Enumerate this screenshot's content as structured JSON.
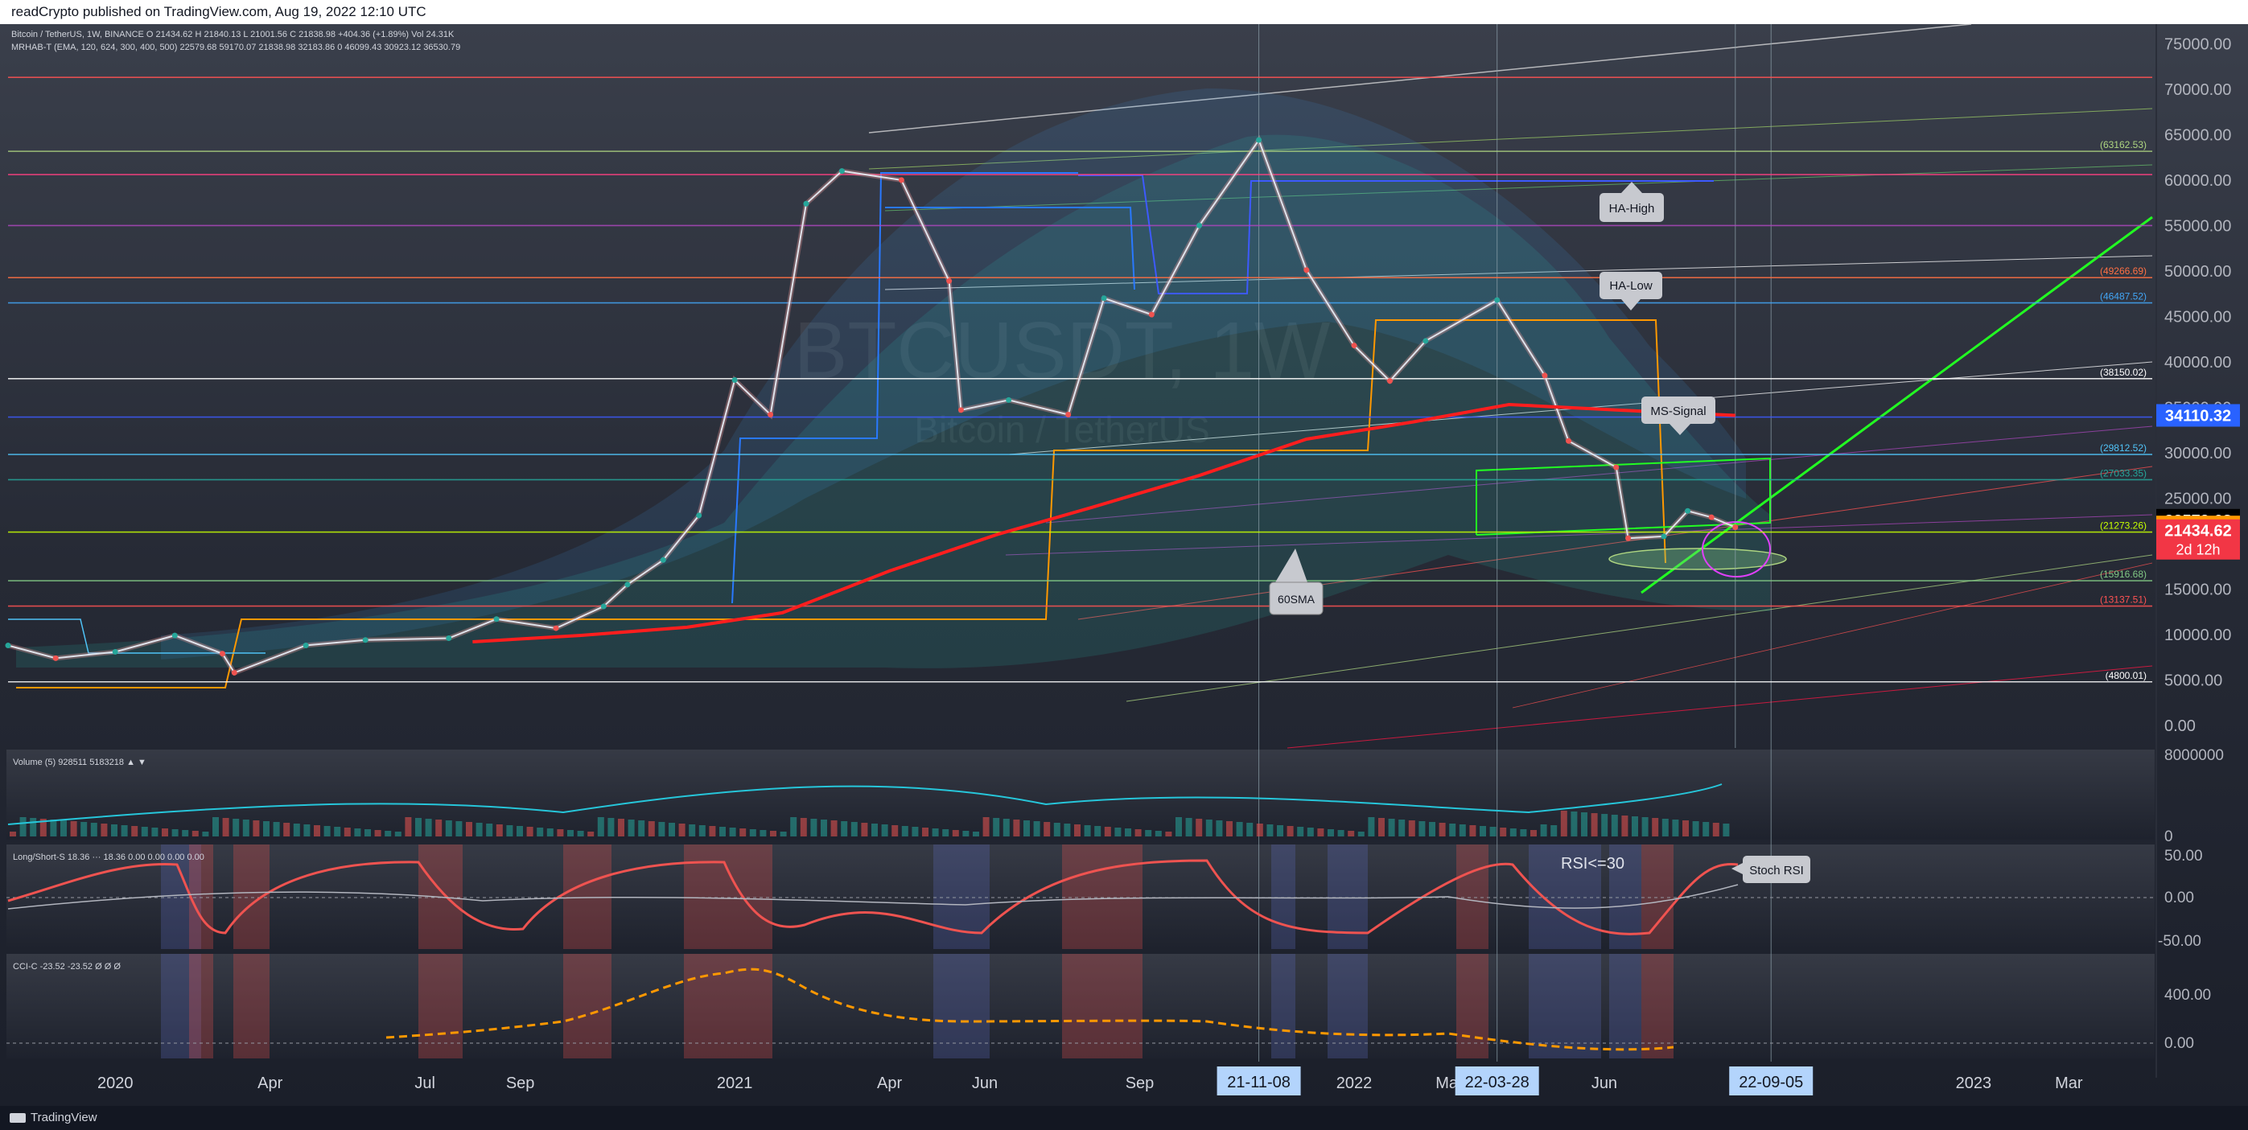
{
  "header": {
    "publish_text": "readCrypto published on TradingView.com, Aug 19, 2022 12:10 UTC"
  },
  "footer": {
    "brand": "TradingView"
  },
  "colors": {
    "bg": "#131722",
    "red": "#ff1e1e",
    "green": "#22ff22",
    "axis_text": "#b2b5be",
    "white": "#ffffff"
  },
  "legend": {
    "line1": "Bitcoin / TetherUS, 1W, BINANCE  O 21434.62  H 21840.13  L 21001.56  C 21838.98  +404.36 (+1.89%)  Vol 24.31K",
    "line2": "MRHAB-T (EMA, 120, 624, 300, 400, 500)  22579.68  59170.07  21838.98  32183.86  0  46099.43  30923.12  36530.79"
  },
  "watermark": {
    "symbol": "BTCUSDT, 1W",
    "name": "Bitcoin / TetherUS"
  },
  "chart_data": {
    "type": "candlestick",
    "symbol": "BTCUSDT",
    "interval": "1W",
    "ylim": [
      0,
      77500
    ],
    "yticks": [
      0,
      5000,
      10000,
      15000,
      20000,
      25000,
      30000,
      35000,
      40000,
      45000,
      50000,
      55000,
      60000,
      65000,
      70000,
      75000
    ],
    "ytick_labels": [
      "0.00",
      "5000.00",
      "10000.00",
      "15000.00",
      "20000.00",
      "25000.00",
      "30000.00",
      "35000.00",
      "40000.00",
      "45000.00",
      "50000.00",
      "55000.00",
      "60000.00",
      "65000.00",
      "70000.00",
      "75000.00"
    ],
    "x_start": "2019-11-04",
    "x_end": "2023-04-17",
    "xticks": [
      {
        "label": "2020",
        "date": "2020-01-06"
      },
      {
        "label": "Apr",
        "date": "2020-04-06"
      },
      {
        "label": "Jul",
        "date": "2020-07-06"
      },
      {
        "label": "Sep",
        "date": "2020-08-31"
      },
      {
        "label": "2021",
        "date": "2021-01-04"
      },
      {
        "label": "Apr",
        "date": "2021-04-05"
      },
      {
        "label": "Jun",
        "date": "2021-05-31"
      },
      {
        "label": "Sep",
        "date": "2021-08-30"
      },
      {
        "label": "2022",
        "date": "2022-01-03"
      },
      {
        "label": "Mar",
        "date": "2022-02-28"
      },
      {
        "label": "Jun",
        "date": "2022-05-30"
      },
      {
        "label": "2023",
        "date": "2023-01-02"
      },
      {
        "label": "Mar",
        "date": "2023-02-27"
      }
    ],
    "date_markers": [
      {
        "label": "21-11-08",
        "date": "2021-11-08"
      },
      {
        "label": "22-03-28",
        "date": "2022-03-28"
      },
      {
        "label": "22-09-05",
        "date": "2022-09-05"
      }
    ],
    "vlines": [
      {
        "date": "2022-08-15"
      }
    ],
    "hlevels": [
      {
        "value": 4800.01,
        "label": "(4800.01)",
        "color": "#ffffff"
      },
      {
        "value": 13137.51,
        "label": "(13137.51)",
        "color": "#ff5252"
      },
      {
        "value": 15916.68,
        "label": "(15916.68)",
        "color": "#81c784"
      },
      {
        "value": 21273.26,
        "label": "(21273.26)",
        "color": "#c6ff00"
      },
      {
        "value": 27033.35,
        "label": "(27033.35)",
        "color": "#26a69a"
      },
      {
        "value": 29812.52,
        "label": "(29812.52)",
        "color": "#4fc3f7"
      },
      {
        "value": 33923.0,
        "label": "",
        "color": "#3d5afe"
      },
      {
        "value": 38150.02,
        "label": "(38150.02)",
        "color": "#ffffff"
      },
      {
        "value": 46487.52,
        "label": "(46487.52)",
        "color": "#42a5f5"
      },
      {
        "value": 49266.69,
        "label": "(49266.69)",
        "color": "#ff7043"
      },
      {
        "value": 55000.0,
        "label": "",
        "color": "#ab47bc"
      },
      {
        "value": 60600.0,
        "label": "",
        "color": "#ff4081"
      },
      {
        "value": 63162.53,
        "label": "(63162.53)",
        "color": "#aed581"
      },
      {
        "value": 71300.0,
        "label": "",
        "color": "#ff5252"
      }
    ],
    "price_tags": [
      {
        "value": 34110.32,
        "label": "34110.32",
        "bg": "#2962ff",
        "fg": "#ffffff"
      },
      {
        "value": 22579.68,
        "label": "22579.68",
        "bg": "#000000",
        "fg": "#ffffff"
      },
      {
        "value": 21838.98,
        "label": "21838.98",
        "bg": "#ff9800",
        "fg": "#000000"
      },
      {
        "value": 21434.62,
        "label": "21434.62",
        "bg": "#f23645",
        "fg": "#ffffff",
        "sub": "2d 12h"
      }
    ],
    "close_series": {
      "name": "BTCUSDT weekly close",
      "x": [
        "2019-11-04",
        "2019-12-02",
        "2020-01-06",
        "2020-02-10",
        "2020-03-09",
        "2020-03-16",
        "2020-04-27",
        "2020-06-01",
        "2020-07-20",
        "2020-08-17",
        "2020-09-21",
        "2020-10-19",
        "2020-11-02",
        "2020-11-23",
        "2020-12-14",
        "2021-01-04",
        "2021-01-25",
        "2021-02-15",
        "2021-03-08",
        "2021-04-12",
        "2021-05-10",
        "2021-05-17",
        "2021-06-14",
        "2021-07-19",
        "2021-08-09",
        "2021-09-06",
        "2021-10-04",
        "2021-11-08",
        "2021-12-06",
        "2022-01-03",
        "2022-01-24",
        "2022-02-14",
        "2022-03-28",
        "2022-04-25",
        "2022-05-09",
        "2022-06-06",
        "2022-06-13",
        "2022-07-04",
        "2022-07-18",
        "2022-08-01",
        "2022-08-15"
      ],
      "y": [
        8800,
        7400,
        8100,
        9900,
        7900,
        5800,
        8800,
        9400,
        9600,
        11700,
        10700,
        13100,
        15500,
        18200,
        23100,
        38000,
        34200,
        57400,
        61000,
        60000,
        48900,
        34700,
        35800,
        34200,
        47000,
        45200,
        55000,
        64400,
        50100,
        41800,
        37900,
        42300,
        46800,
        38500,
        31300,
        28400,
        20600,
        20800,
        23600,
        22900,
        21800
      ]
    },
    "sma60": {
      "name": "60SMA",
      "x": [
        "2020-08-03",
        "2020-10-05",
        "2020-12-07",
        "2021-02-01",
        "2021-04-05",
        "2021-06-07",
        "2021-08-02",
        "2021-10-04",
        "2021-12-06",
        "2022-02-07",
        "2022-04-04",
        "2022-06-06",
        "2022-08-15"
      ],
      "y": [
        9200,
        9900,
        10800,
        12400,
        17000,
        21000,
        24000,
        27500,
        31500,
        33400,
        35300,
        34700,
        34110
      ]
    },
    "annotations": [
      "60SMA",
      "HA-High",
      "HA-Low",
      "MS-Signal",
      "RSI<=30",
      "Stoch RSI"
    ]
  },
  "volume_panel": {
    "label": "Volume (5)  928511  5183218  ▲  ▼",
    "ytick_labels": [
      "8000000",
      "0"
    ]
  },
  "stoch_panel": {
    "label": "Long/Short-S  18.36  ···  18.36  0.00  0.00  0.00  0.00",
    "ytick_labels": [
      "50.00",
      "0.00",
      "-50.00"
    ]
  },
  "cci_panel": {
    "label": "CCI-C  -23.52  -23.52  Ø  Ø  Ø",
    "ytick_labels": [
      "400.00",
      "0.00"
    ]
  }
}
